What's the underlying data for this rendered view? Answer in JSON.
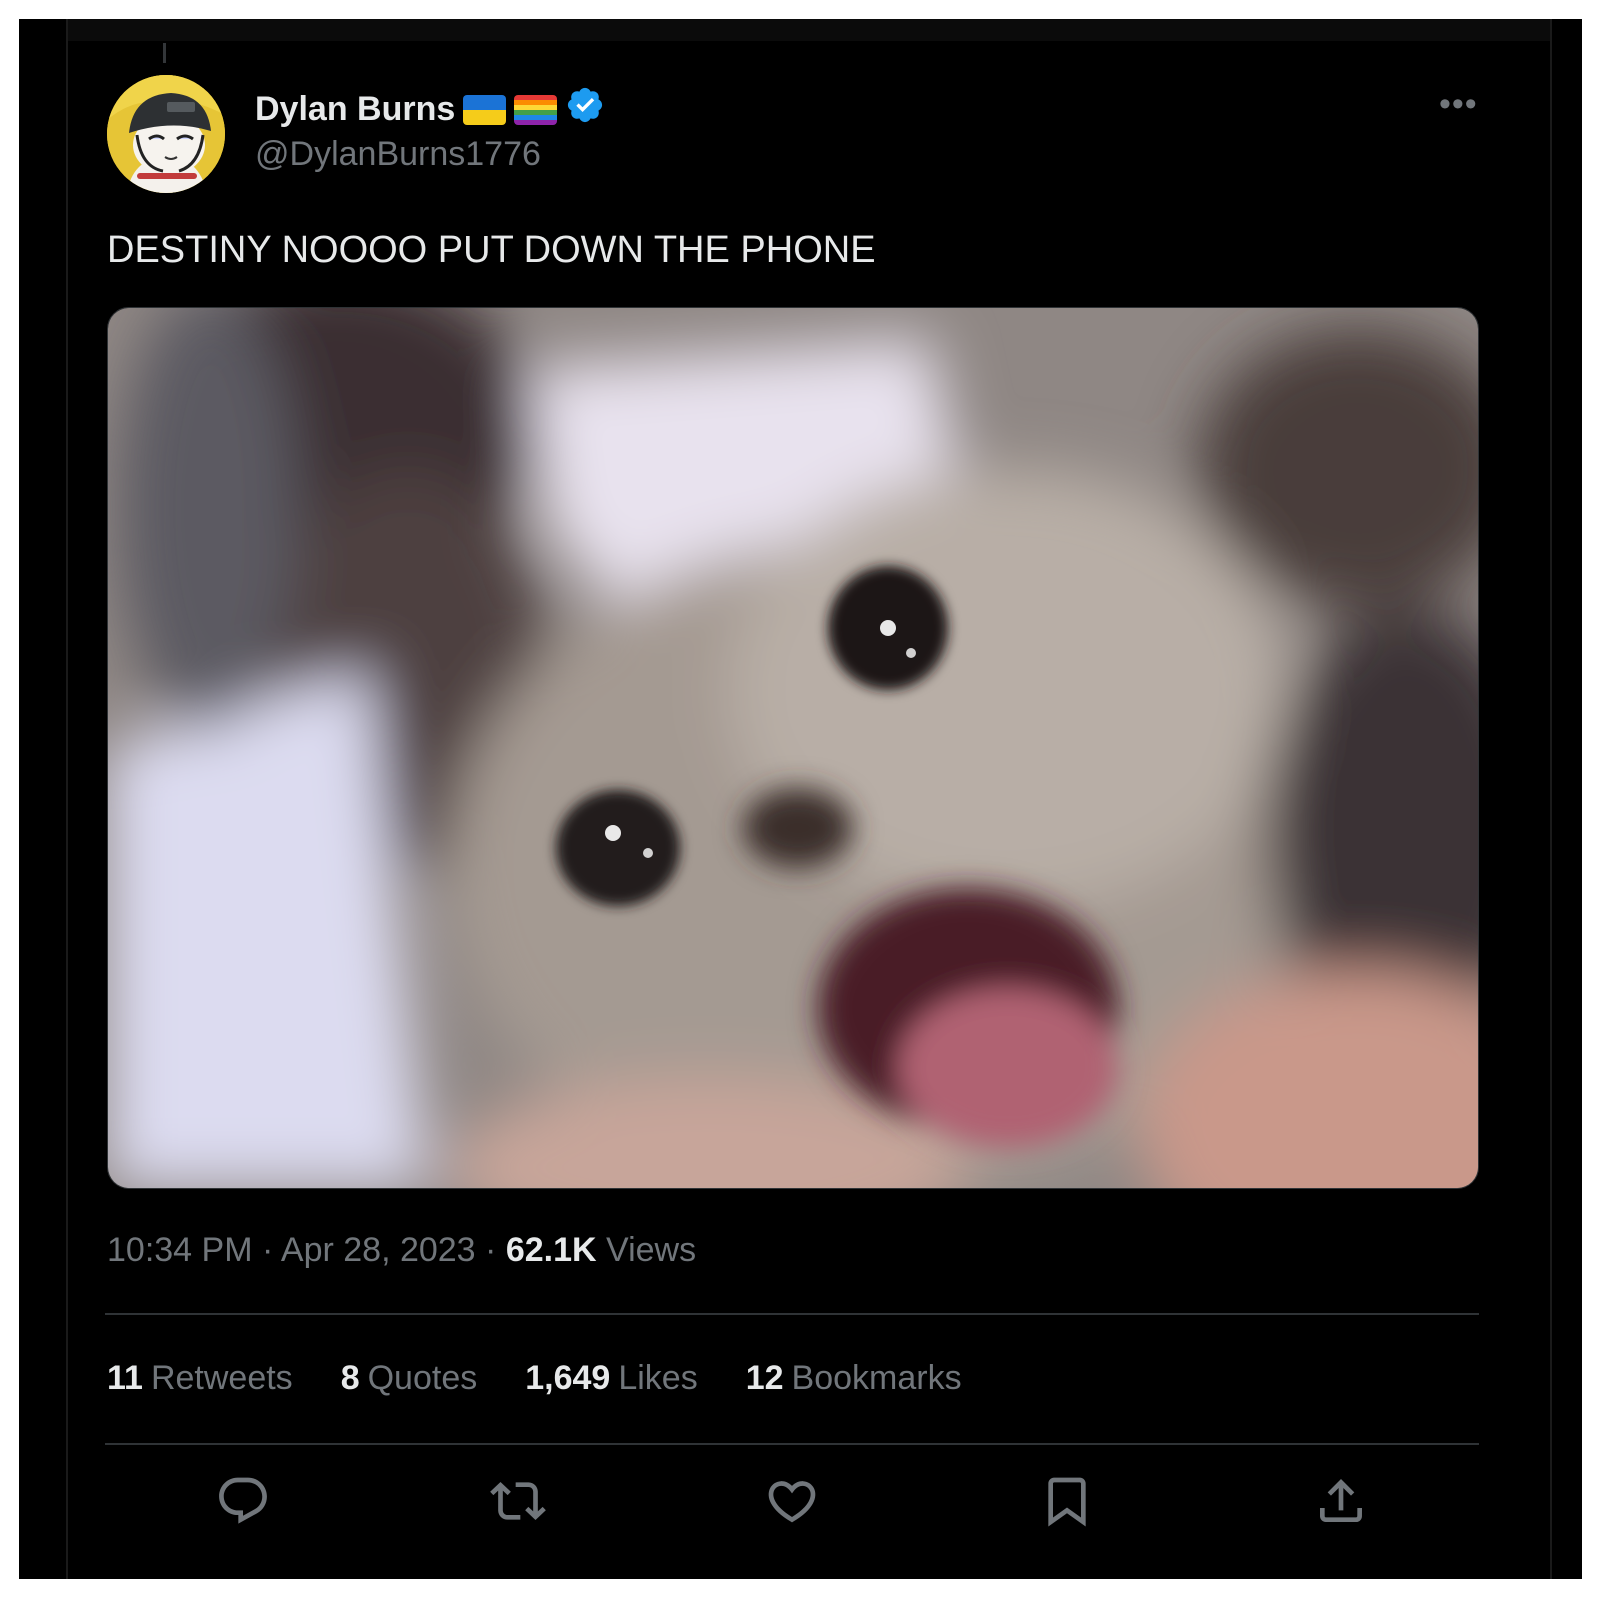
{
  "author": {
    "display_name": "Dylan Burns",
    "handle": "@DylanBurns1776",
    "badges": [
      "ukraine-flag",
      "rainbow-flag",
      "verified-badge"
    ],
    "avatar_icon": "cartoon-cat-with-press-helmet"
  },
  "tweet": {
    "text": "DESTINY NOOOO PUT DOWN THE PHONE",
    "media_description_icon": "crying-kitten-photo"
  },
  "meta": {
    "time": "10:34 PM",
    "separator": "·",
    "date": "Apr 28, 2023",
    "views_count": "62.1K",
    "views_label": "Views"
  },
  "stats": {
    "retweets": {
      "count": "11",
      "label": "Retweets"
    },
    "quotes": {
      "count": "8",
      "label": "Quotes"
    },
    "likes": {
      "count": "1,649",
      "label": "Likes"
    },
    "bookmarks": {
      "count": "12",
      "label": "Bookmarks"
    }
  },
  "actions": [
    "reply-icon",
    "retweet-icon",
    "like-icon",
    "bookmark-icon",
    "share-icon"
  ],
  "colors": {
    "background": "#000000",
    "text_primary": "#e7e9ea",
    "text_secondary": "#71767b",
    "divider": "#2f3336",
    "verified": "#1d9bf0"
  }
}
